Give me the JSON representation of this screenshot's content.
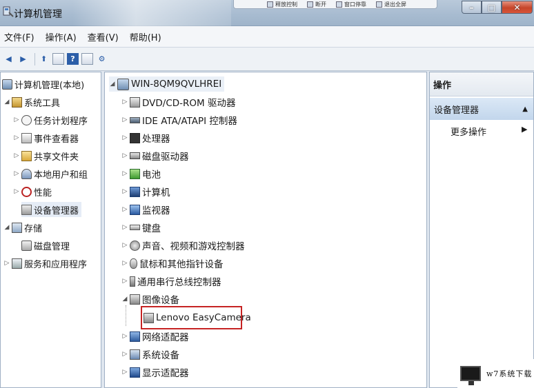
{
  "window": {
    "title": "计算机管理",
    "buttons": {
      "minimize": "–",
      "maximize": "□",
      "close": "✕"
    }
  },
  "remote_toolbar": [
    "释放控制",
    "断开",
    "窗口停靠",
    "退出全屏"
  ],
  "menu": [
    "文件(F)",
    "操作(A)",
    "查看(V)",
    "帮助(H)"
  ],
  "toolbar": {
    "icons": [
      "back-arrow-icon",
      "forward-arrow-icon",
      "up-folder-icon",
      "properties-icon",
      "help-icon",
      "show-hide-icon",
      "scan-hardware-icon"
    ]
  },
  "left_tree": {
    "root": "计算机管理(本地)",
    "items": [
      {
        "label": "系统工具",
        "level": 1,
        "expanded": true,
        "icon": "tools-icon"
      },
      {
        "label": "任务计划程序",
        "level": 2,
        "icon": "clock-icon"
      },
      {
        "label": "事件查看器",
        "level": 2,
        "icon": "event-log-icon"
      },
      {
        "label": "共享文件夹",
        "level": 2,
        "icon": "shared-folder-icon"
      },
      {
        "label": "本地用户和组",
        "level": 2,
        "icon": "users-icon"
      },
      {
        "label": "性能",
        "level": 2,
        "icon": "performance-icon"
      },
      {
        "label": "设备管理器",
        "level": 2,
        "icon": "device-manager-icon",
        "selected": true
      },
      {
        "label": "存储",
        "level": 1,
        "expanded": true,
        "icon": "storage-icon"
      },
      {
        "label": "磁盘管理",
        "level": 2,
        "icon": "disk-icon"
      },
      {
        "label": "服务和应用程序",
        "level": 1,
        "icon": "services-icon"
      }
    ]
  },
  "device_tree": {
    "root": "WIN-8QM9QVLHREI",
    "categories": [
      {
        "label": "DVD/CD-ROM 驱动器",
        "icon": "dvd-icon"
      },
      {
        "label": "IDE ATA/ATAPI 控制器",
        "icon": "ide-controller-icon"
      },
      {
        "label": "处理器",
        "icon": "processor-icon"
      },
      {
        "label": "磁盘驱动器",
        "icon": "disk-drive-icon"
      },
      {
        "label": "电池",
        "icon": "battery-icon"
      },
      {
        "label": "计算机",
        "icon": "computer-icon"
      },
      {
        "label": "监视器",
        "icon": "monitor-icon"
      },
      {
        "label": "键盘",
        "icon": "keyboard-icon"
      },
      {
        "label": "声音、视频和游戏控制器",
        "icon": "sound-icon"
      },
      {
        "label": "鼠标和其他指针设备",
        "icon": "mouse-icon"
      },
      {
        "label": "通用串行总线控制器",
        "icon": "usb-icon"
      },
      {
        "label": "图像设备",
        "icon": "imaging-icon",
        "expanded": true
      },
      {
        "label": "Lenovo EasyCamera",
        "icon": "camera-icon",
        "child": true,
        "highlighted": true
      },
      {
        "label": "网络适配器",
        "icon": "network-icon"
      },
      {
        "label": "系统设备",
        "icon": "system-device-icon"
      },
      {
        "label": "显示适配器",
        "icon": "display-adapter-icon"
      }
    ]
  },
  "actions": {
    "header": "操作",
    "section": "设备管理器",
    "more": "更多操作"
  },
  "watermark": "w7系统下载",
  "colors": {
    "highlight_border": "#c62323",
    "selection": "#e5ecf6",
    "title_bar": "#a7bbd0"
  }
}
